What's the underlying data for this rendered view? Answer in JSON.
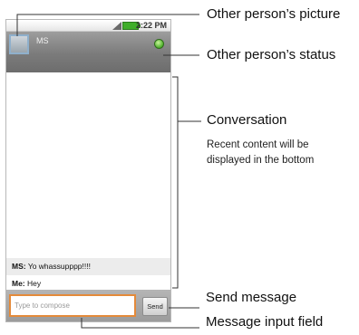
{
  "phone": {
    "statusbar": {
      "clock": "2:22 PM"
    },
    "header": {
      "contact_name": "MS",
      "status_color": "#4caf2a"
    },
    "messages": [
      {
        "sender": "MS:",
        "text": "Yo whassupppp!!!!"
      },
      {
        "sender": "Me:",
        "text": "Hey"
      }
    ],
    "composer": {
      "placeholder": "Type to compose",
      "send_label": "Send"
    }
  },
  "callouts": {
    "picture": "Other person’s picture",
    "status": "Other person’s status",
    "conversation_title": "Conversation",
    "conversation_desc_line1": "Recent content will be",
    "conversation_desc_line2": "displayed in the bottom",
    "send": "Send message",
    "input": "Message input field"
  }
}
